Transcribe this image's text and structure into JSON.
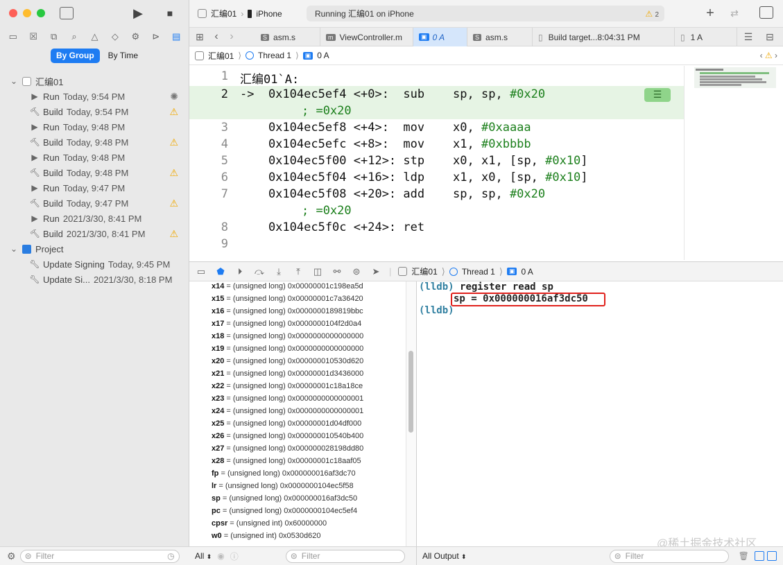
{
  "toolbar": {
    "scheme": "汇编01",
    "device": "iPhone",
    "status": "Running 汇编01 on iPhone",
    "warning_count": "2"
  },
  "navigator": {
    "seg_group": "By Group",
    "seg_time": "By Time",
    "root": "汇编01",
    "items": [
      {
        "kind": "Run",
        "time": "Today, 9:54 PM",
        "badge": "spinner"
      },
      {
        "kind": "Build",
        "time": "Today, 9:54 PM",
        "badge": "warning"
      },
      {
        "kind": "Run",
        "time": "Today, 9:48 PM",
        "badge": ""
      },
      {
        "kind": "Build",
        "time": "Today, 9:48 PM",
        "badge": "warning"
      },
      {
        "kind": "Run",
        "time": "Today, 9:48 PM",
        "badge": ""
      },
      {
        "kind": "Build",
        "time": "Today, 9:48 PM",
        "badge": "warning"
      },
      {
        "kind": "Run",
        "time": "Today, 9:47 PM",
        "badge": ""
      },
      {
        "kind": "Build",
        "time": "Today, 9:47 PM",
        "badge": "warning"
      },
      {
        "kind": "Run",
        "time": "2021/3/30, 8:41 PM",
        "badge": ""
      },
      {
        "kind": "Build",
        "time": "2021/3/30, 8:41 PM",
        "badge": "warning"
      }
    ],
    "project": "Project",
    "project_items": [
      {
        "kind": "Update Signing",
        "time": "Today, 9:45 PM"
      },
      {
        "kind": "Update Si...",
        "time": "2021/3/30, 8:18 PM"
      }
    ],
    "filter_placeholder": "Filter"
  },
  "tabs": [
    {
      "label": "asm.s",
      "icon": "S"
    },
    {
      "label": "ViewController.m",
      "icon": "m"
    },
    {
      "label": "0 A",
      "icon": "thread"
    },
    {
      "label": "asm.s",
      "icon": "S"
    },
    {
      "label": "Build target...8:04:31 PM",
      "icon": "doc"
    },
    {
      "label": "1 A",
      "icon": "doc"
    }
  ],
  "jumpbar": {
    "project": "汇编01",
    "thread": "Thread 1",
    "frame": "0 A"
  },
  "code": {
    "header": "汇编01`A:",
    "lines": [
      {
        "n": "2",
        "text": "->  0x104ec5ef4 <+0>:  sub    sp, sp, ",
        "lit": "#0x20",
        "tail": "",
        "comment": "; =0x20"
      },
      {
        "n": "3",
        "text": "    0x104ec5ef8 <+4>:  mov    x0, ",
        "lit": "#0xaaaa",
        "tail": "",
        "comment": ""
      },
      {
        "n": "4",
        "text": "    0x104ec5efc <+8>:  mov    x1, ",
        "lit": "#0xbbbb",
        "tail": "",
        "comment": ""
      },
      {
        "n": "5",
        "text": "    0x104ec5f00 <+12>: stp    x0, x1, [sp, ",
        "lit": "#0x10",
        "tail": "]",
        "comment": ""
      },
      {
        "n": "6",
        "text": "    0x104ec5f04 <+16>: ldp    x1, x0, [sp, ",
        "lit": "#0x10",
        "tail": "]",
        "comment": ""
      },
      {
        "n": "7",
        "text": "    0x104ec5f08 <+20>: add    sp, sp, ",
        "lit": "#0x20",
        "tail": "",
        "comment": "; =0x20"
      },
      {
        "n": "8",
        "text": "    0x104ec5f0c <+24>: ret",
        "lit": "",
        "tail": "",
        "comment": ""
      },
      {
        "n": "9",
        "text": "",
        "lit": "",
        "tail": "",
        "comment": ""
      }
    ],
    "line1": "1"
  },
  "debugbar": {
    "project": "汇编01",
    "thread": "Thread 1",
    "frame": "0 A"
  },
  "variables": [
    {
      "name": "x14",
      "value": "(unsigned long) 0x00000001c198ea5d"
    },
    {
      "name": "x15",
      "value": "(unsigned long) 0x00000001c7a36420"
    },
    {
      "name": "x16",
      "value": "(unsigned long) 0x0000000189819bbc"
    },
    {
      "name": "x17",
      "value": "(unsigned long) 0x0000000104f2d0a4"
    },
    {
      "name": "x18",
      "value": "(unsigned long) 0x0000000000000000"
    },
    {
      "name": "x19",
      "value": "(unsigned long) 0x0000000000000000"
    },
    {
      "name": "x20",
      "value": "(unsigned long) 0x000000010530d620"
    },
    {
      "name": "x21",
      "value": "(unsigned long) 0x00000001d3436000"
    },
    {
      "name": "x22",
      "value": "(unsigned long) 0x00000001c18a18ce"
    },
    {
      "name": "x23",
      "value": "(unsigned long) 0x0000000000000001"
    },
    {
      "name": "x24",
      "value": "(unsigned long) 0x0000000000000001"
    },
    {
      "name": "x25",
      "value": "(unsigned long) 0x00000001d04df000"
    },
    {
      "name": "x26",
      "value": "(unsigned long) 0x000000010540b400"
    },
    {
      "name": "x27",
      "value": "(unsigned long) 0x000000028198dd80"
    },
    {
      "name": "x28",
      "value": "(unsigned long) 0x00000001c18aaf05"
    },
    {
      "name": "fp",
      "value": "(unsigned long) 0x000000016af3dc70"
    },
    {
      "name": "lr",
      "value": "(unsigned long) 0x0000000104ec5f58"
    },
    {
      "name": "sp",
      "value": "(unsigned long) 0x000000016af3dc50"
    },
    {
      "name": "pc",
      "value": "(unsigned long) 0x0000000104ec5ef4"
    },
    {
      "name": "cpsr",
      "value": "(unsigned int) 0x60000000"
    },
    {
      "name": "w0",
      "value": "(unsigned int) 0x0530d620"
    }
  ],
  "console": {
    "prompt": "(lldb)",
    "command": "register read sp",
    "output": "sp = 0x000000016af3dc50",
    "highlight_color": "#e0201b"
  },
  "bottom": {
    "vars_scope": "All",
    "vars_filter": "Filter",
    "console_scope": "All Output",
    "console_filter": "Filter"
  },
  "watermark": "@稀土掘金技术社区"
}
